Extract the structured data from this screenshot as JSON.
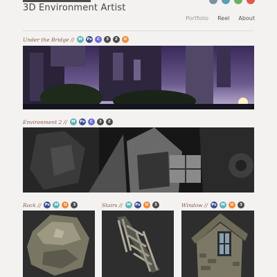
{
  "site": {
    "title": "3D Environment Artist"
  },
  "nav": [
    {
      "label": "Portfolio"
    },
    {
      "label": "Reel"
    },
    {
      "label": "About"
    }
  ],
  "social_colors": [
    "#7a8fa6",
    "#5aa0b4",
    "#6bb05e",
    "#e05a4a"
  ],
  "sections": [
    {
      "title": "Under the Bridge //",
      "badges": [
        {
          "icon": "marmoset",
          "text": "M",
          "color": "#5fb3b3"
        },
        {
          "icon": "photoshop",
          "text": "Ps",
          "color": "#3d4d8f"
        },
        {
          "icon": "crazybump",
          "text": "C",
          "color": "#6b6bd6"
        },
        {
          "icon": "3dsmax",
          "text": "3",
          "color": "#4a4a4a"
        },
        {
          "icon": "zbrush",
          "text": "Z",
          "color": "#4a4a4a"
        },
        {
          "icon": "unreal",
          "text": "U",
          "color": "#f08a3a"
        }
      ]
    },
    {
      "title": "Environment 2 //",
      "badges": [
        {
          "icon": "marmoset",
          "text": "M",
          "color": "#5fb3b3"
        },
        {
          "icon": "photoshop",
          "text": "Ps",
          "color": "#3d4d8f"
        },
        {
          "icon": "crazybump",
          "text": "C",
          "color": "#6b6bd6"
        },
        {
          "icon": "3dsmax",
          "text": "3",
          "color": "#4a4a4a"
        },
        {
          "icon": "zbrush",
          "text": "Z",
          "color": "#4a4a4a"
        }
      ]
    },
    {
      "title": "Rock //",
      "badges": [
        {
          "icon": "photoshop",
          "text": "Ps",
          "color": "#3d4d8f"
        },
        {
          "icon": "marmoset",
          "text": "M",
          "color": "#5fb3b3"
        },
        {
          "icon": "unreal",
          "text": "U",
          "color": "#f08a3a"
        },
        {
          "icon": "3dsmax",
          "text": "3",
          "color": "#4a4a4a"
        }
      ]
    },
    {
      "title": "Stairs //",
      "badges": [
        {
          "icon": "marmoset",
          "text": "M",
          "color": "#5fb3b3"
        },
        {
          "icon": "photoshop",
          "text": "Ps",
          "color": "#3d4d8f"
        },
        {
          "icon": "unreal",
          "text": "U",
          "color": "#f08a3a"
        },
        {
          "icon": "3dsmax",
          "text": "3",
          "color": "#4a4a4a"
        }
      ]
    },
    {
      "title": "Window //",
      "badges": [
        {
          "icon": "photoshop",
          "text": "Ps",
          "color": "#3d4d8f"
        },
        {
          "icon": "marmoset",
          "text": "M",
          "color": "#5fb3b3"
        },
        {
          "icon": "unreal",
          "text": "U",
          "color": "#f08a3a"
        },
        {
          "icon": "3dsmax",
          "text": "3",
          "color": "#4a4a4a"
        }
      ]
    }
  ]
}
